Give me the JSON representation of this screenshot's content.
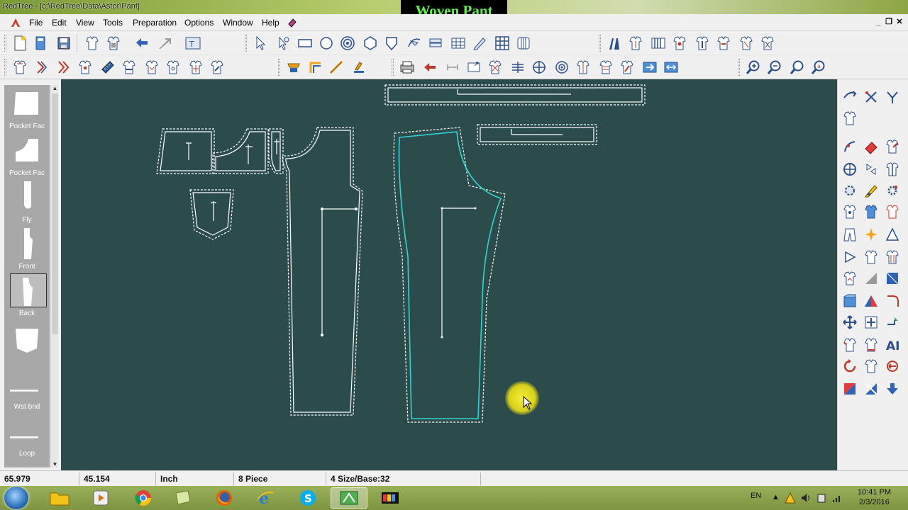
{
  "window": {
    "title": "RedTree - [c:\\RedTree\\Data\\Astor\\Pant]",
    "banner": "Woven Pant",
    "controls": [
      "_",
      "❐",
      "✕"
    ]
  },
  "menu": {
    "items": [
      "File",
      "Edit",
      "View",
      "Tools",
      "Preparation",
      "Options",
      "Window",
      "Help"
    ]
  },
  "toolbar1": {
    "icons": [
      "new-file-icon",
      "open-file-icon",
      "save-icon",
      "garment-copy-icon",
      "garment-paste-icon",
      "undo-icon",
      "redo-icon",
      "import-export-icon",
      "select-pointer-icon",
      "point-select-icon",
      "rectangle-icon",
      "circle-icon",
      "spiral-icon",
      "hexagon-icon",
      "shield-shape-icon",
      "curve-tool-icon",
      "stack-icon",
      "grid-icon",
      "pencil-icon",
      "grid-large-icon",
      "columns-icon",
      "marker-icon",
      "garment-pleat-icon",
      "vertical-lines-icon",
      "garment-a-icon",
      "garment-b-icon",
      "garment-c-icon",
      "garment-d-icon",
      "garment-e-icon"
    ]
  },
  "toolbar2": {
    "icons": [
      "garment-f-icon",
      "notch-icon",
      "double-notch-icon",
      "garment-g-icon",
      "ruler-icon",
      "garment-h-icon",
      "garment-i-icon",
      "garment-j-icon",
      "garment-k-icon",
      "garment-l-icon",
      "stamp-icon",
      "corner-icon",
      "line-icon",
      "pen-icon",
      "printer-icon",
      "arrow-left-icon",
      "measure-icon",
      "resize-icon",
      "garment-m-icon",
      "align-icon",
      "crosshair-icon",
      "target-icon",
      "garment-n-icon",
      "garment-o-icon",
      "garment-p-icon",
      "flip-icon",
      "expand-icon",
      "zoom-in-icon",
      "zoom-out-icon",
      "zoom-fit-icon",
      "zoom-reset-icon"
    ]
  },
  "pieces": [
    {
      "label": "Pocket Fac",
      "shape": "rect"
    },
    {
      "label": "Pocket Fac",
      "shape": "step"
    },
    {
      "label": "Fly",
      "shape": "fly"
    },
    {
      "label": "Front",
      "shape": "front"
    },
    {
      "label": "Back",
      "shape": "back",
      "selected": true
    },
    {
      "label": "",
      "shape": "pocket"
    },
    {
      "label": "Wst bnd",
      "shape": "line"
    },
    {
      "label": "Loop",
      "shape": "line"
    }
  ],
  "status": {
    "x": "65.979",
    "y": "45.154",
    "unit": "Inch",
    "pieces": "8 Piece",
    "size": "4 Size/Base:32"
  },
  "taskbar": {
    "apps": [
      "explorer-icon",
      "media-player-icon",
      "chrome-icon",
      "notes-icon",
      "firefox-icon",
      "ie-icon",
      "skype-icon",
      "redtree-icon",
      "color-app-icon"
    ],
    "language": "EN",
    "time": "10:41 PM",
    "date": "2/3/2016"
  }
}
